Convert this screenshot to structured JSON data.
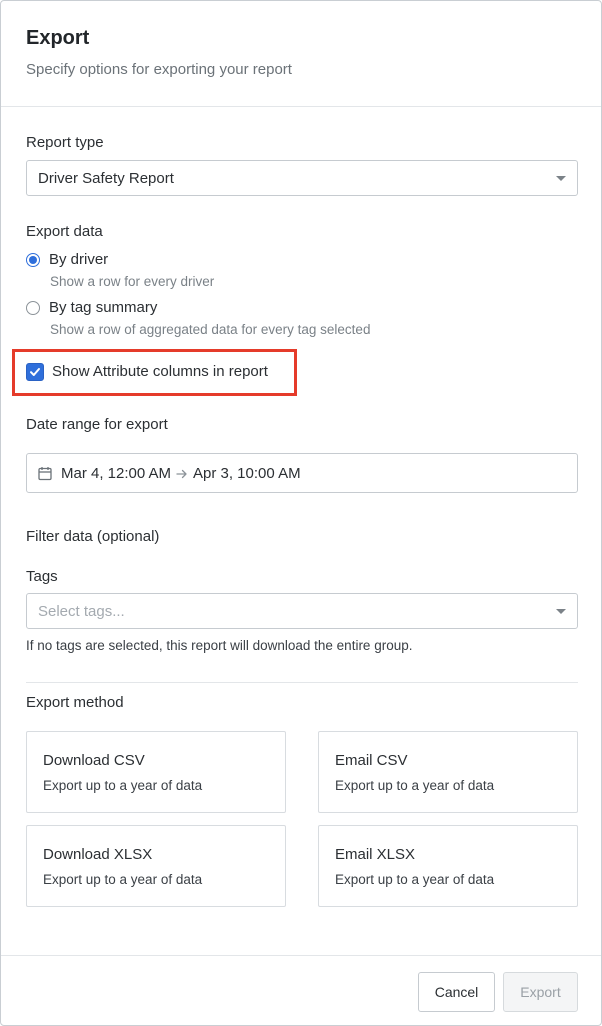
{
  "header": {
    "title": "Export",
    "subtitle": "Specify options for exporting your report"
  },
  "report_type": {
    "label": "Report type",
    "selected": "Driver Safety Report"
  },
  "export_data": {
    "label": "Export data",
    "options": [
      {
        "label": "By driver",
        "hint": "Show a row for every driver",
        "checked": true
      },
      {
        "label": "By tag summary",
        "hint": "Show a row of aggregated data for every tag selected",
        "checked": false
      }
    ]
  },
  "attribute_checkbox": {
    "label": "Show Attribute columns in report",
    "checked": true
  },
  "date_range": {
    "label": "Date range for export",
    "start": "Mar 4, 12:00 AM",
    "end": "Apr 3, 10:00 AM"
  },
  "filter": {
    "label": "Filter data (optional)",
    "tags_label": "Tags",
    "tags_placeholder": "Select tags...",
    "helper": "If no tags are selected, this report will download the entire group."
  },
  "export_method": {
    "label": "Export method",
    "cards": [
      {
        "title": "Download CSV",
        "desc": "Export up to a year of data"
      },
      {
        "title": "Email CSV",
        "desc": "Export up to a year of data"
      },
      {
        "title": "Download XLSX",
        "desc": "Export up to a year of data"
      },
      {
        "title": "Email XLSX",
        "desc": "Export up to a year of data"
      }
    ]
  },
  "footer": {
    "cancel_label": "Cancel",
    "export_label": "Export"
  },
  "colors": {
    "accent": "#2f6fdb",
    "highlight": "#e53b2a"
  },
  "icons": {
    "calendar": "calendar-icon",
    "arrow": "arrow-right-icon",
    "caret": "chevron-down-icon",
    "check": "check-icon"
  }
}
